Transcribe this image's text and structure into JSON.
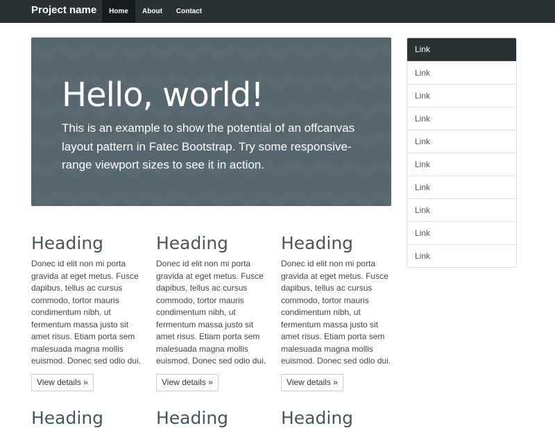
{
  "navbar": {
    "brand": "Project name",
    "items": [
      {
        "label": "Home",
        "active": true
      },
      {
        "label": "About",
        "active": false
      },
      {
        "label": "Contact",
        "active": false
      }
    ]
  },
  "jumbotron": {
    "title": "Hello, world!",
    "text": "This is an example to show the potential of an offcanvas layout pattern in Fatec Bootstrap. Try some responsive-range viewport sizes to see it in action."
  },
  "columns": [
    {
      "heading": "Heading",
      "body": "Donec id elit non mi porta gravida at eget metus. Fusce dapibus, tellus ac cursus commodo, tortor mauris condimentum nibh, ut fermentum massa justo sit amet risus. Etiam porta sem malesuada magna mollis euismod. Donec sed odio dui.",
      "button": "View details »"
    },
    {
      "heading": "Heading",
      "body": "Donec id elit non mi porta gravida at eget metus. Fusce dapibus, tellus ac cursus commodo, tortor mauris condimentum nibh, ut fermentum massa justo sit amet risus. Etiam porta sem malesuada magna mollis euismod. Donec sed odio dui.",
      "button": "View details »"
    },
    {
      "heading": "Heading",
      "body": "Donec id elit non mi porta gravida at eget metus. Fusce dapibus, tellus ac cursus commodo, tortor mauris condimentum nibh, ut fermentum massa justo sit amet risus. Etiam porta sem malesuada magna mollis euismod. Donec sed odio dui.",
      "button": "View details »"
    }
  ],
  "next_row": [
    "Heading",
    "Heading",
    "Heading"
  ],
  "sidebar": {
    "links": [
      "Link",
      "Link",
      "Link",
      "Link",
      "Link",
      "Link",
      "Link",
      "Link",
      "Link",
      "Link"
    ],
    "active_index": 0
  },
  "colors": {
    "navbar_bg": "#2a3236",
    "navbar_active": "#161b1e",
    "jumbotron_bg": "#56666c",
    "heading": "#47555c",
    "sidebar_active": "#2a3236"
  }
}
